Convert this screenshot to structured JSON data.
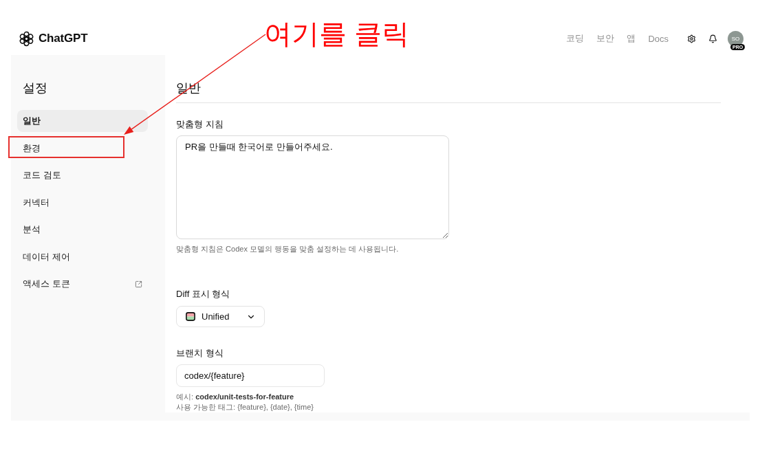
{
  "header": {
    "logo_text": "ChatGPT",
    "nav_links": [
      "코딩",
      "보안",
      "앱",
      "Docs"
    ],
    "avatar": {
      "initials": "SO",
      "badge": "PRO"
    }
  },
  "annotation": {
    "text": "여기를 클릭"
  },
  "sidebar": {
    "title": "설정",
    "items": [
      {
        "label": "일반",
        "selected": true,
        "highlighted": false,
        "external": false
      },
      {
        "label": "환경",
        "selected": false,
        "highlighted": true,
        "external": false
      },
      {
        "label": "코드 검토",
        "selected": false,
        "highlighted": false,
        "external": false
      },
      {
        "label": "커넥터",
        "selected": false,
        "highlighted": false,
        "external": false
      },
      {
        "label": "분석",
        "selected": false,
        "highlighted": false,
        "external": false
      },
      {
        "label": "데이터 제어",
        "selected": false,
        "highlighted": false,
        "external": false
      },
      {
        "label": "액세스 토큰",
        "selected": false,
        "highlighted": false,
        "external": true
      }
    ]
  },
  "main": {
    "title": "일반",
    "custom_instructions": {
      "label": "맞춤형 지침",
      "value": "PR을 만들때 한국어로 만들어주세요.",
      "help": "맞춤형 지침은 Codex 모델의 행동을 맞춤 설정하는 데 사용됩니다."
    },
    "diff_format": {
      "label": "Diff 표시 형식",
      "value": "Unified"
    },
    "branch_format": {
      "label": "브랜치 형식",
      "value": "codex/{feature}",
      "example": "예시: **codex/unit-tests-for-feature**",
      "tags": "사용 가능한 태그: {feature}, {date}, {time}"
    }
  }
}
